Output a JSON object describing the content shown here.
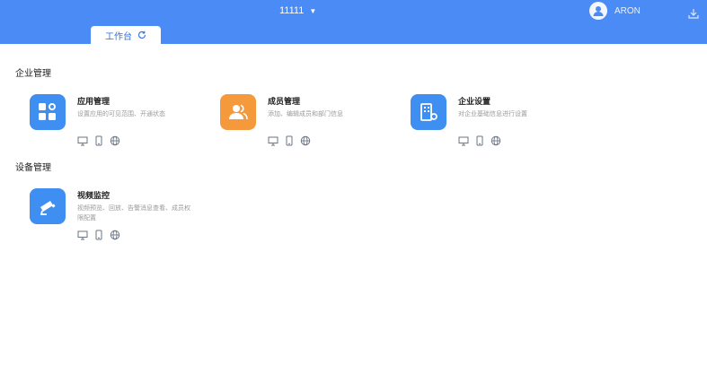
{
  "header": {
    "org_name": "11111",
    "org_caret": "▼",
    "user_name": "ARON"
  },
  "tabs": [
    {
      "label": "工作台"
    }
  ],
  "sections": [
    {
      "title": "企业管理",
      "apps": [
        {
          "name": "应用管理",
          "desc": "设置应用的可见范围、开通状态",
          "color": "#3f8ff2",
          "icon": "app-grid-icon"
        },
        {
          "name": "成员管理",
          "desc": "添加、编辑成员和部门信息",
          "color": "#f59a3c",
          "icon": "members-icon"
        },
        {
          "name": "企业设置",
          "desc": "对企业基础信息进行设置",
          "color": "#3f8ff2",
          "icon": "building-icon"
        }
      ]
    },
    {
      "title": "设备管理",
      "apps": [
        {
          "name": "视频监控",
          "desc": "视频预览、回放、告警消息查看、成员权限配置",
          "color": "#3f8ff2",
          "icon": "camera-icon"
        }
      ]
    }
  ],
  "platform_icons": [
    "desktop-icon",
    "mobile-icon",
    "web-icon"
  ]
}
